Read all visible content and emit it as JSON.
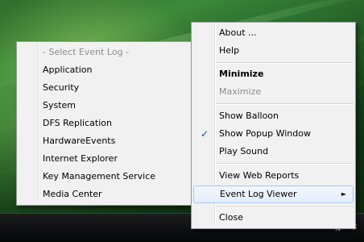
{
  "colors": {
    "menu_background": "#f1f1f1",
    "highlight": "#e3eefb",
    "highlight_border": "#a8c8ec",
    "disabled_text": "#8d8d8d",
    "check_color": "#1b4fb3"
  },
  "context_menu": {
    "items": [
      {
        "label": "About ..."
      },
      {
        "label": "Help"
      },
      {
        "label": "Minimize"
      },
      {
        "label": "Maximize"
      },
      {
        "label": "Show Balloon"
      },
      {
        "label": "Show Popup Window",
        "checked": true
      },
      {
        "label": "Play Sound"
      },
      {
        "label": "View Web Reports"
      },
      {
        "label": "Event Log Viewer",
        "submenu_arrow": "►",
        "highlighted": true
      },
      {
        "label": "Close"
      }
    ],
    "check_glyph": "✓"
  },
  "event_log_submenu": {
    "items": [
      {
        "label": "- Select Event Log -"
      },
      {
        "label": "Application"
      },
      {
        "label": "Security"
      },
      {
        "label": "System"
      },
      {
        "label": "DFS Replication"
      },
      {
        "label": "HardwareEvents"
      },
      {
        "label": "Internet Explorer"
      },
      {
        "label": "Key Management Service"
      },
      {
        "label": "Media Center"
      }
    ]
  },
  "tray": {
    "icons": [
      "network-icon",
      "app-tray-icon"
    ]
  }
}
